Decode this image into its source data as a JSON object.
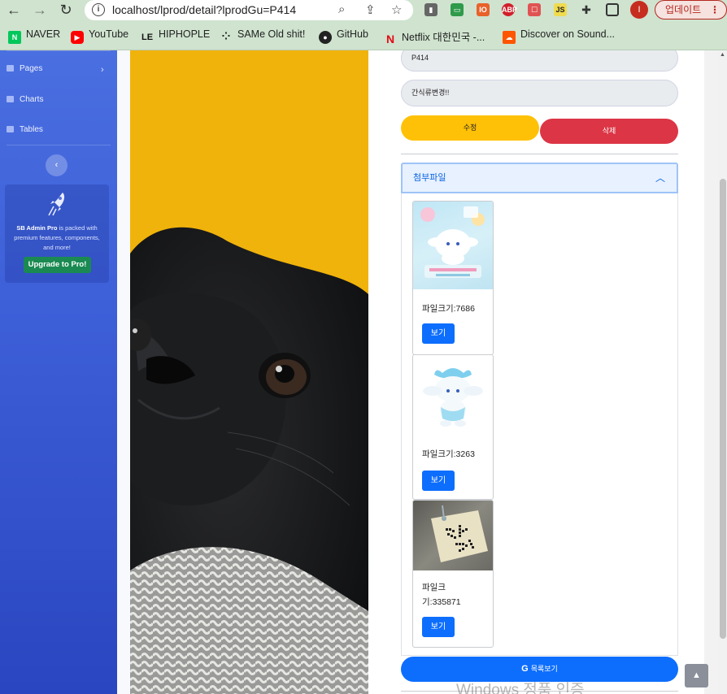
{
  "browser": {
    "url": "localhost/lprod/detail?lprodGu=P414",
    "profile_initial": "I",
    "update_label": "업데이트",
    "update_menu": "⋮"
  },
  "bookmarks": [
    {
      "label": "NAVER",
      "icon": "naver-icon",
      "color": "#03c75a",
      "glyph": "N"
    },
    {
      "label": "YouTube",
      "icon": "youtube-icon",
      "color": "#ff0000",
      "glyph": "▶"
    },
    {
      "label": "HIPHOPLE",
      "icon": "hiphople-icon",
      "color": "#111111",
      "glyph": "LE"
    },
    {
      "label": "SAMe Old shit!",
      "icon": "same-old-icon",
      "color": "#222222",
      "glyph": "⁘"
    },
    {
      "label": "GitHub",
      "icon": "github-icon",
      "color": "#222222",
      "glyph": "●"
    },
    {
      "label": "Netflix 대한민국 -...",
      "icon": "netflix-icon",
      "color": "#e50914",
      "glyph": "N"
    },
    {
      "label": "Discover on Sound...",
      "icon": "soundcloud-icon",
      "color": "#ff5500",
      "glyph": "☁"
    }
  ],
  "sidebar": {
    "items": [
      {
        "label": "Pages",
        "icon": "folder-icon"
      },
      {
        "label": "Charts",
        "icon": "chart-area-icon"
      },
      {
        "label": "Tables",
        "icon": "table-icon"
      }
    ],
    "toggle_glyph": "‹",
    "promo": {
      "brand": "SB Admin Pro",
      "text": "is packed with premium features, components, and more!",
      "button": "Upgrade to Pro!"
    }
  },
  "form": {
    "code_value": "P414",
    "name_value": "간식류변경!!",
    "edit_label": "수정",
    "delete_label": "삭제"
  },
  "attachments": {
    "title": "첨부파일",
    "files": [
      {
        "size_label": "파일크기:7686",
        "button": "보기",
        "thumb": "cinnamoroll-book"
      },
      {
        "size_label": "파일크기:3263",
        "button": "보기",
        "thumb": "cinnamoroll-plush"
      },
      {
        "size_label": "파일크기:335871",
        "button": "보기",
        "thumb": "note-paper"
      }
    ]
  },
  "footer": {
    "list_button": "목록보기",
    "list_icon": "G",
    "watermark": "Windows 정품 인증"
  },
  "colors": {
    "sidebar": "#4a6fe0",
    "warning": "#ffc107",
    "danger": "#dc3545",
    "primary": "#0d6efd",
    "image_bg": "#f0b30b"
  }
}
